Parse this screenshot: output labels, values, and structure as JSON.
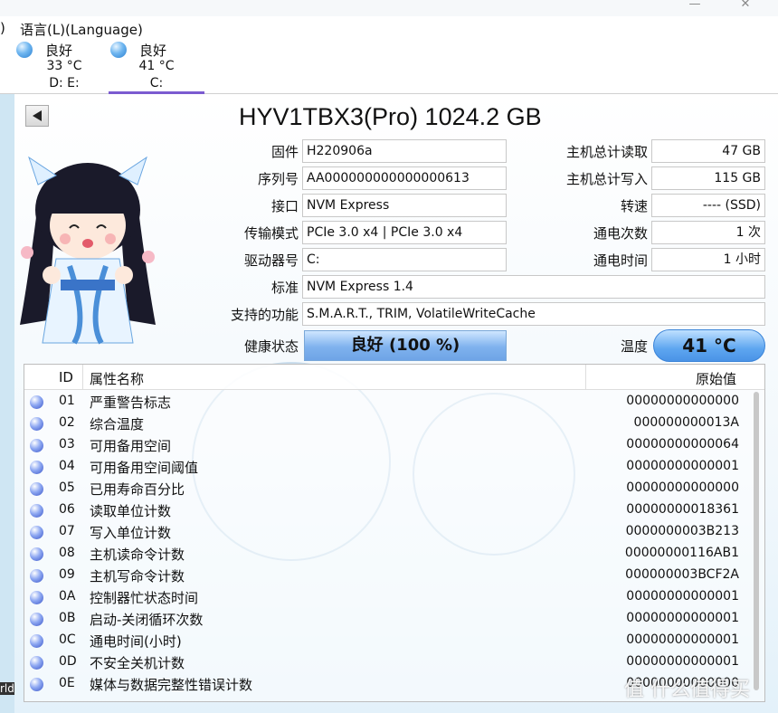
{
  "menu": {
    "prev_fragment": ")",
    "language": "语言(L)(Language)"
  },
  "window_controls": {
    "minimize": "—",
    "close": "✕"
  },
  "drives": [
    {
      "status": "良好",
      "temp": "33 °C",
      "letters": "D: E:",
      "selected": false
    },
    {
      "status": "良好",
      "temp": "41 °C",
      "letters": "C:",
      "selected": true
    }
  ],
  "disk": {
    "model": "HYV1TBX3(Pro) 1024.2 GB",
    "firmware_label": "固件",
    "firmware": "H220906a",
    "serial_label": "序列号",
    "serial": "AA000000000000000613",
    "interface_label": "接口",
    "interface": "NVM Express",
    "transfer_label": "传输模式",
    "transfer": "PCIe 3.0 x4 | PCIe 3.0 x4",
    "drive_letter_label": "驱动器号",
    "drive_letter": "C:",
    "standard_label": "标准",
    "standard": "NVM Express 1.4",
    "features_label": "支持的功能",
    "features": "S.M.A.R.T., TRIM, VolatileWriteCache",
    "health_label": "健康状态",
    "health": "良好 (100 %)",
    "host_reads_label": "主机总计读取",
    "host_reads": "47 GB",
    "host_writes_label": "主机总计写入",
    "host_writes": "115 GB",
    "rotation_label": "转速",
    "rotation": "---- (SSD)",
    "power_count_label": "通电次数",
    "power_count": "1 次",
    "power_hours_label": "通电时间",
    "power_hours": "1 小时",
    "temp_label": "温度",
    "temp": "41 °C"
  },
  "table": {
    "headers": {
      "id": "ID",
      "name": "属性名称",
      "raw": "原始值"
    },
    "rows": [
      {
        "id": "01",
        "name": "严重警告标志",
        "raw": "00000000000000"
      },
      {
        "id": "02",
        "name": "综合温度",
        "raw": "000000000013A"
      },
      {
        "id": "03",
        "name": "可用备用空间",
        "raw": "00000000000064"
      },
      {
        "id": "04",
        "name": "可用备用空间阈值",
        "raw": "00000000000001"
      },
      {
        "id": "05",
        "name": "已用寿命百分比",
        "raw": "00000000000000"
      },
      {
        "id": "06",
        "name": "读取单位计数",
        "raw": "00000000018361"
      },
      {
        "id": "07",
        "name": "写入单位计数",
        "raw": "0000000003B213"
      },
      {
        "id": "08",
        "name": "主机读命令计数",
        "raw": "00000000116AB1"
      },
      {
        "id": "09",
        "name": "主机写命令计数",
        "raw": "000000003BCF2A"
      },
      {
        "id": "0A",
        "name": "控制器忙状态时间",
        "raw": "00000000000001"
      },
      {
        "id": "0B",
        "name": "启动-关闭循环次数",
        "raw": "00000000000001"
      },
      {
        "id": "0C",
        "name": "通电时间(小时)",
        "raw": "00000000000001"
      },
      {
        "id": "0D",
        "name": "不安全关机计数",
        "raw": "00000000000001"
      },
      {
        "id": "0E",
        "name": "媒体与数据完整性错误计数",
        "raw": "00000000000000"
      }
    ]
  },
  "watermark": "值 什么值得买",
  "edge_text": "rld",
  "colors": {
    "accent": "#7b5bd0",
    "health_blue": "#7fb2ee",
    "temp_blue": "#5ea6f0",
    "status_dot": "#6fb6f0"
  }
}
